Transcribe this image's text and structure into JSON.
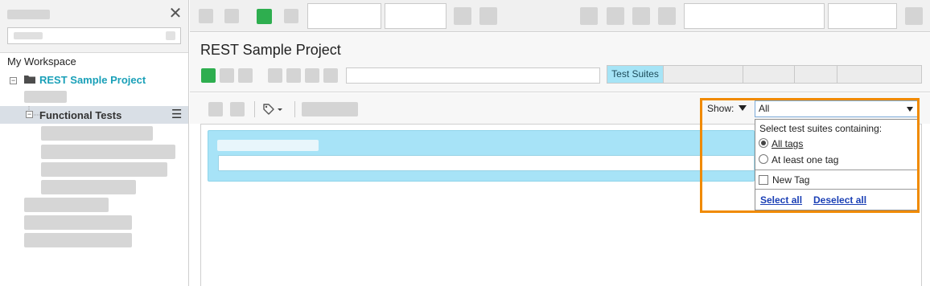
{
  "sidebar": {
    "workspace_label": "My Workspace",
    "project_label": "REST Sample Project",
    "selected_item_label": "Functional Tests",
    "menu_glyph": "☰",
    "close_glyph": "✕"
  },
  "main": {
    "title": "REST Sample Project",
    "tabs": [
      {
        "label": "Test Suites",
        "active": true
      }
    ]
  },
  "filter": {
    "show_label": "Show:",
    "selected_value": "All",
    "popup": {
      "heading": "Select test suites containing:",
      "options": [
        {
          "label": "All tags",
          "selected": true
        },
        {
          "label": "At least one tag",
          "selected": false
        }
      ],
      "tags": [
        {
          "label": "New Tag",
          "checked": false
        }
      ],
      "select_all": "Select all",
      "deselect_all": "Deselect all"
    }
  },
  "colors": {
    "accent": "#1aa0b8",
    "highlight_border": "#f08a00",
    "active_tab": "#a6e4f6",
    "run_button": "#2eae4f",
    "suite_card": "#a7e3f7"
  },
  "icons": [
    "close-icon",
    "folder-icon",
    "tag-icon",
    "menu-icon",
    "dropdown-arrow-icon",
    "run-icon"
  ]
}
